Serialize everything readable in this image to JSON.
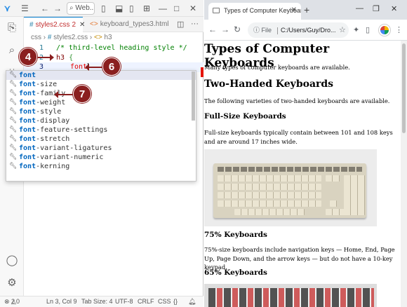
{
  "vscode": {
    "search_text": "Web...",
    "tabs": [
      {
        "label": "styles2.css",
        "badge": "2"
      },
      {
        "label": "keyboard_types3.html"
      }
    ],
    "breadcrumb": {
      "part1": "css",
      "part2": "styles2.css",
      "part3": "h3"
    },
    "lines": [
      {
        "num": "1",
        "text": "/* third-level heading style */"
      },
      {
        "num": "2",
        "selector": "h3",
        "brace": "{"
      },
      {
        "num": "3",
        "text": "font"
      }
    ],
    "suggestions": [
      "font",
      "font-size",
      "font-family",
      "font-weight",
      "font-style",
      "font-display",
      "font-feature-settings",
      "font-stretch",
      "font-variant-ligatures",
      "font-variant-numeric",
      "font-kerning"
    ],
    "suggest_prefix": "font",
    "status": {
      "errors": "2",
      "warnings": "0",
      "position": "Ln 3, Col 9",
      "tab_size": "Tab Size: 4",
      "encoding": "UTF-8",
      "eol": "CRLF",
      "language": "CSS"
    }
  },
  "browser": {
    "tab_title": "Types of Computer Keyboards",
    "address_label": "File",
    "address": "C:/Users/Guy/Dro...",
    "page": {
      "h1": "Types of Computer Keyboards",
      "intro": "Many types of computer keyboards are available.",
      "h2": "Two-Handed Keyboards",
      "h2_text": "The following varieties of two-handed keyboards are available.",
      "h3_full": "Full-Size Keyboards",
      "full_text": "Full-size keyboards typically contain between 101 and 108 keys and are around 17 inches wide.",
      "h3_75": "75% Keyboards",
      "text_75": "75%-size keyboards include navigation keys — Home, End, Page Up, Page Down, and the arrow keys — but do not have a 10-key keypad.",
      "h3_65": "65% Keyboards"
    }
  },
  "callouts": {
    "c4": "4",
    "c6": "6",
    "c7": "7"
  },
  "colors": {
    "callout": "#8a1f1f",
    "vscode_accent": "#007acc",
    "error": "#c23030"
  }
}
